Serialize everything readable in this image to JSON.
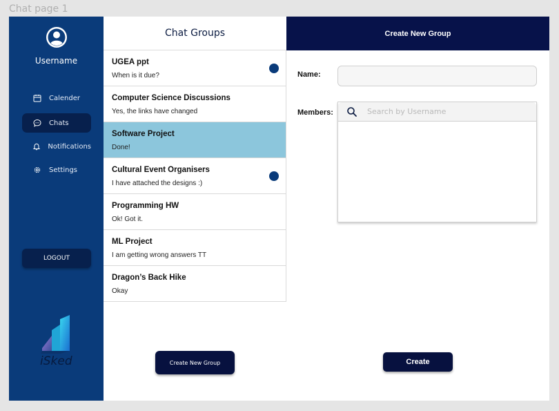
{
  "page": {
    "frame_label": "Chat page 1"
  },
  "sidebar": {
    "avatar_icon": "user-circle-icon",
    "username": "Username",
    "items": [
      {
        "label": "Calender",
        "icon": "calendar-icon",
        "active": false
      },
      {
        "label": "Chats",
        "icon": "chat-bubble-icon",
        "active": true
      },
      {
        "label": "Notifications",
        "icon": "bell-icon",
        "active": false
      },
      {
        "label": "Settings",
        "icon": "gear-icon",
        "active": false
      }
    ],
    "logout_label": "LOGOUT",
    "logo_text": "iSked"
  },
  "groups": {
    "title": "Chat Groups",
    "items": [
      {
        "title": "UGEA  ppt",
        "message": "When is it due?",
        "unread": true,
        "selected": false
      },
      {
        "title": "Computer Science Discussions",
        "message": "Yes, the links have changed",
        "unread": false,
        "selected": false
      },
      {
        "title": "Software Project",
        "message": "Done!",
        "unread": false,
        "selected": true
      },
      {
        "title": "Cultural Event Organisers",
        "message": "I have attached the designs :)",
        "unread": true,
        "selected": false
      },
      {
        "title": "Programming HW",
        "message": "Ok! Got it.",
        "unread": false,
        "selected": false
      },
      {
        "title": "ML Project",
        "message": "I am getting wrong answers TT",
        "unread": false,
        "selected": false
      },
      {
        "title": "Dragon’s Back Hike",
        "message": "Okay",
        "unread": false,
        "selected": false
      }
    ],
    "create_button_label": "Create New Group"
  },
  "create_panel": {
    "title": "Create New Group",
    "name_label": "Name:",
    "name_value": "",
    "members_label": "Members:",
    "search_placeholder": "Search by Username",
    "create_label": "Create"
  },
  "colors": {
    "sidebar": "#0a3b7a",
    "dark_navy": "#07124a",
    "selected_row": "#8cc6dc",
    "unread_dot": "#0a3b7a"
  }
}
